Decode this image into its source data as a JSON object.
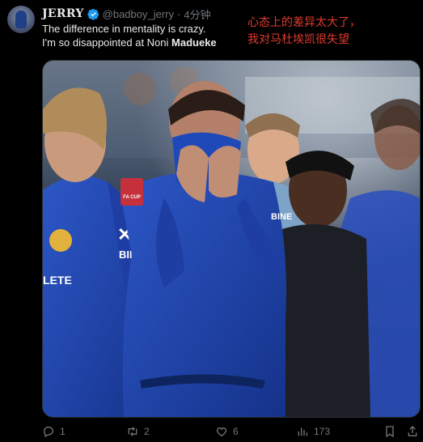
{
  "tweet": {
    "author_name": "JERRY",
    "handle": "@badboy_jerry",
    "separator": "·",
    "time": "4分钟",
    "text_line1": "The difference in mentality is crazy.",
    "text_line2_prefix": "I'm so disappointed at Noni ",
    "text_line2_bold": "Madueke",
    "annotation_line1": "心态上的差异太大了，",
    "annotation_line2": "我对马杜埃凯很失望"
  },
  "media": {
    "description_icon": "photo",
    "badge_text": "FA CUP",
    "sponsor_text": "BINE",
    "shirt_text_1": "BINE",
    "shirt_text_2": "LETE"
  },
  "actions": {
    "reply_count": "1",
    "retweet_count": "2",
    "like_count": "6",
    "views_count": "173"
  },
  "colors": {
    "background": "#000000",
    "text": "#e7e9ea",
    "muted": "#71767b",
    "annotation": "#e03a2e",
    "verified": "#1d9bf0"
  }
}
